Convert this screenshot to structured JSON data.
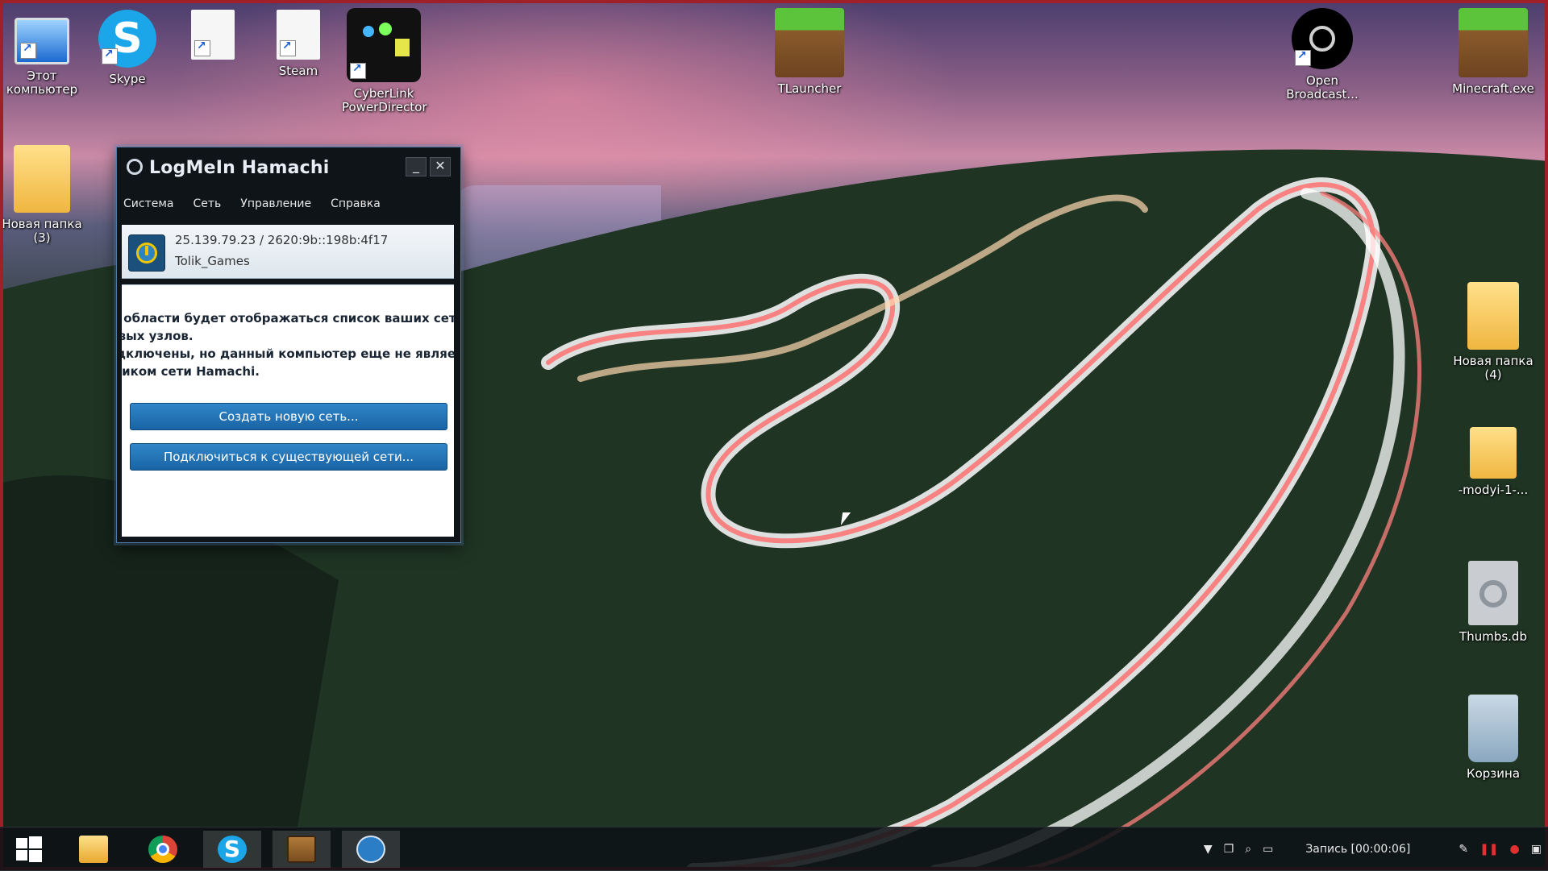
{
  "desktop_icons": [
    {
      "id": "this-pc",
      "label": "Этот компьютер"
    },
    {
      "id": "skype",
      "label": "Skype"
    },
    {
      "id": "steam",
      "label": "Steam"
    },
    {
      "id": "cyberlink",
      "label": "CyberLink PowerDirector"
    },
    {
      "id": "tlauncher",
      "label": "TLauncher"
    },
    {
      "id": "obs",
      "label": "Open Broadcast..."
    },
    {
      "id": "minecraft",
      "label": "Minecraft.exe"
    },
    {
      "id": "new-folder-3",
      "label": "Новая папка (3)"
    },
    {
      "id": "new-folder-4",
      "label": "Новая папка (4)"
    },
    {
      "id": "mody",
      "label": "-modyi-1-..."
    },
    {
      "id": "thumbs",
      "label": "Thumbs.db"
    },
    {
      "id": "recycle",
      "label": "Корзина"
    }
  ],
  "hamachi": {
    "title": "LogMeIn Hamachi",
    "menu": [
      "Система",
      "Сеть",
      "Управление",
      "Справка"
    ],
    "ip": "25.139.79.23 / 2620:9b::198b:4f17",
    "nickname": "Tolik_Games",
    "message_lines": [
      "В этой области будет отображаться список ваших сетей",
      "и сетевых узлов.",
      "Вы подключены, но данный компьютер еще не является",
      "участником сети Hamachi."
    ],
    "create_button": "Создать новую сеть...",
    "join_button": "Подключиться к существующей сети..."
  },
  "taskbar": {
    "recording": "Запись [00:00:06]"
  },
  "colors": {
    "accent_button": "#1f73b7",
    "window_border": "#4d7ba5",
    "desktop_frame": "#a0202a"
  }
}
